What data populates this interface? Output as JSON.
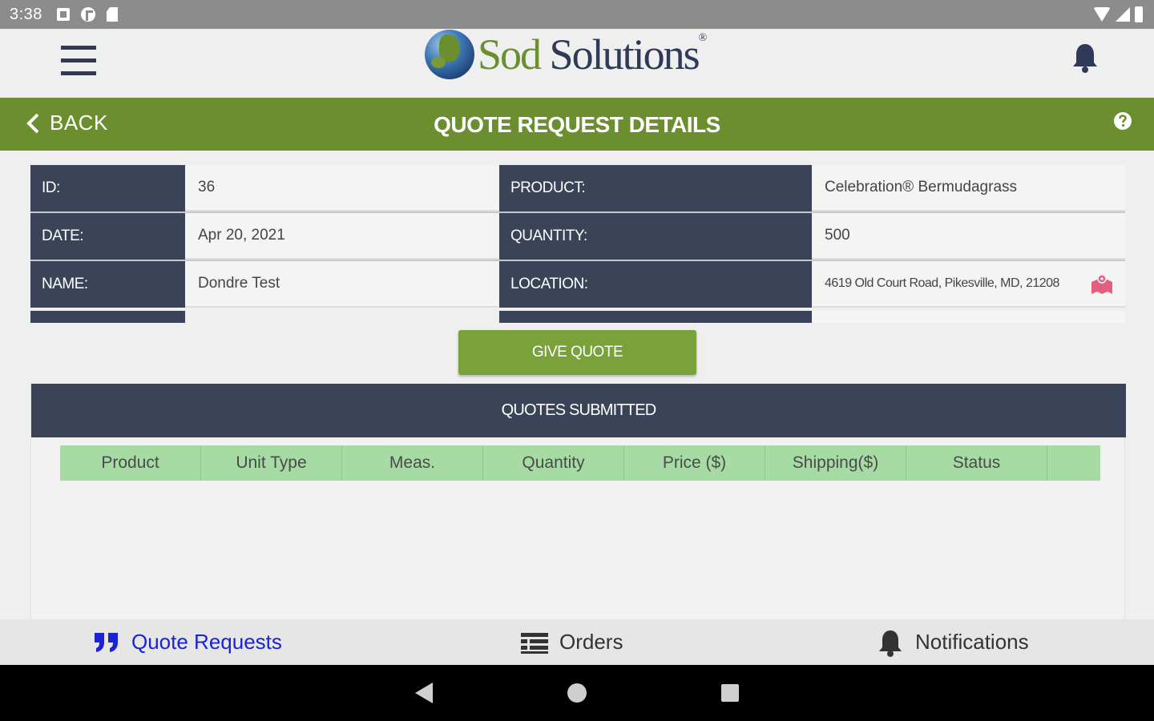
{
  "status_bar": {
    "time": "3:38"
  },
  "header": {
    "logo_part1": "Sod",
    "logo_part2": " Solutions",
    "logo_reg": "®"
  },
  "title_bar": {
    "back_label": "BACK",
    "title": "QUOTE REQUEST DETAILS"
  },
  "details": {
    "id_label": "ID:",
    "id_value": "36",
    "date_label": "DATE:",
    "date_value": "Apr 20, 2021",
    "name_label": "NAME:",
    "name_value": "Dondre Test",
    "product_label": "PRODUCT:",
    "product_value": "Celebration® Bermudagrass",
    "quantity_label": "QUANTITY:",
    "quantity_value": "500",
    "location_label": "LOCATION:",
    "location_value": "4619 Old Court Road, Pikesville, MD, 21208"
  },
  "give_quote_label": "GIVE QUOTE",
  "quotes": {
    "header": "QUOTES SUBMITTED",
    "columns": [
      "Product",
      "Unit Type",
      "Meas.",
      "Quantity",
      "Price ($)",
      "Shipping($)",
      "Status"
    ]
  },
  "bottom_tabs": {
    "quotes": "Quote Requests",
    "orders": "Orders",
    "notifications": "Notifications"
  },
  "colors": {
    "brand_green": "#6b8f2e",
    "navy": "#3a4357",
    "button_green": "#79a33a",
    "header_row_green": "#a6dca4",
    "active_tab_blue": "#1a22d8"
  }
}
